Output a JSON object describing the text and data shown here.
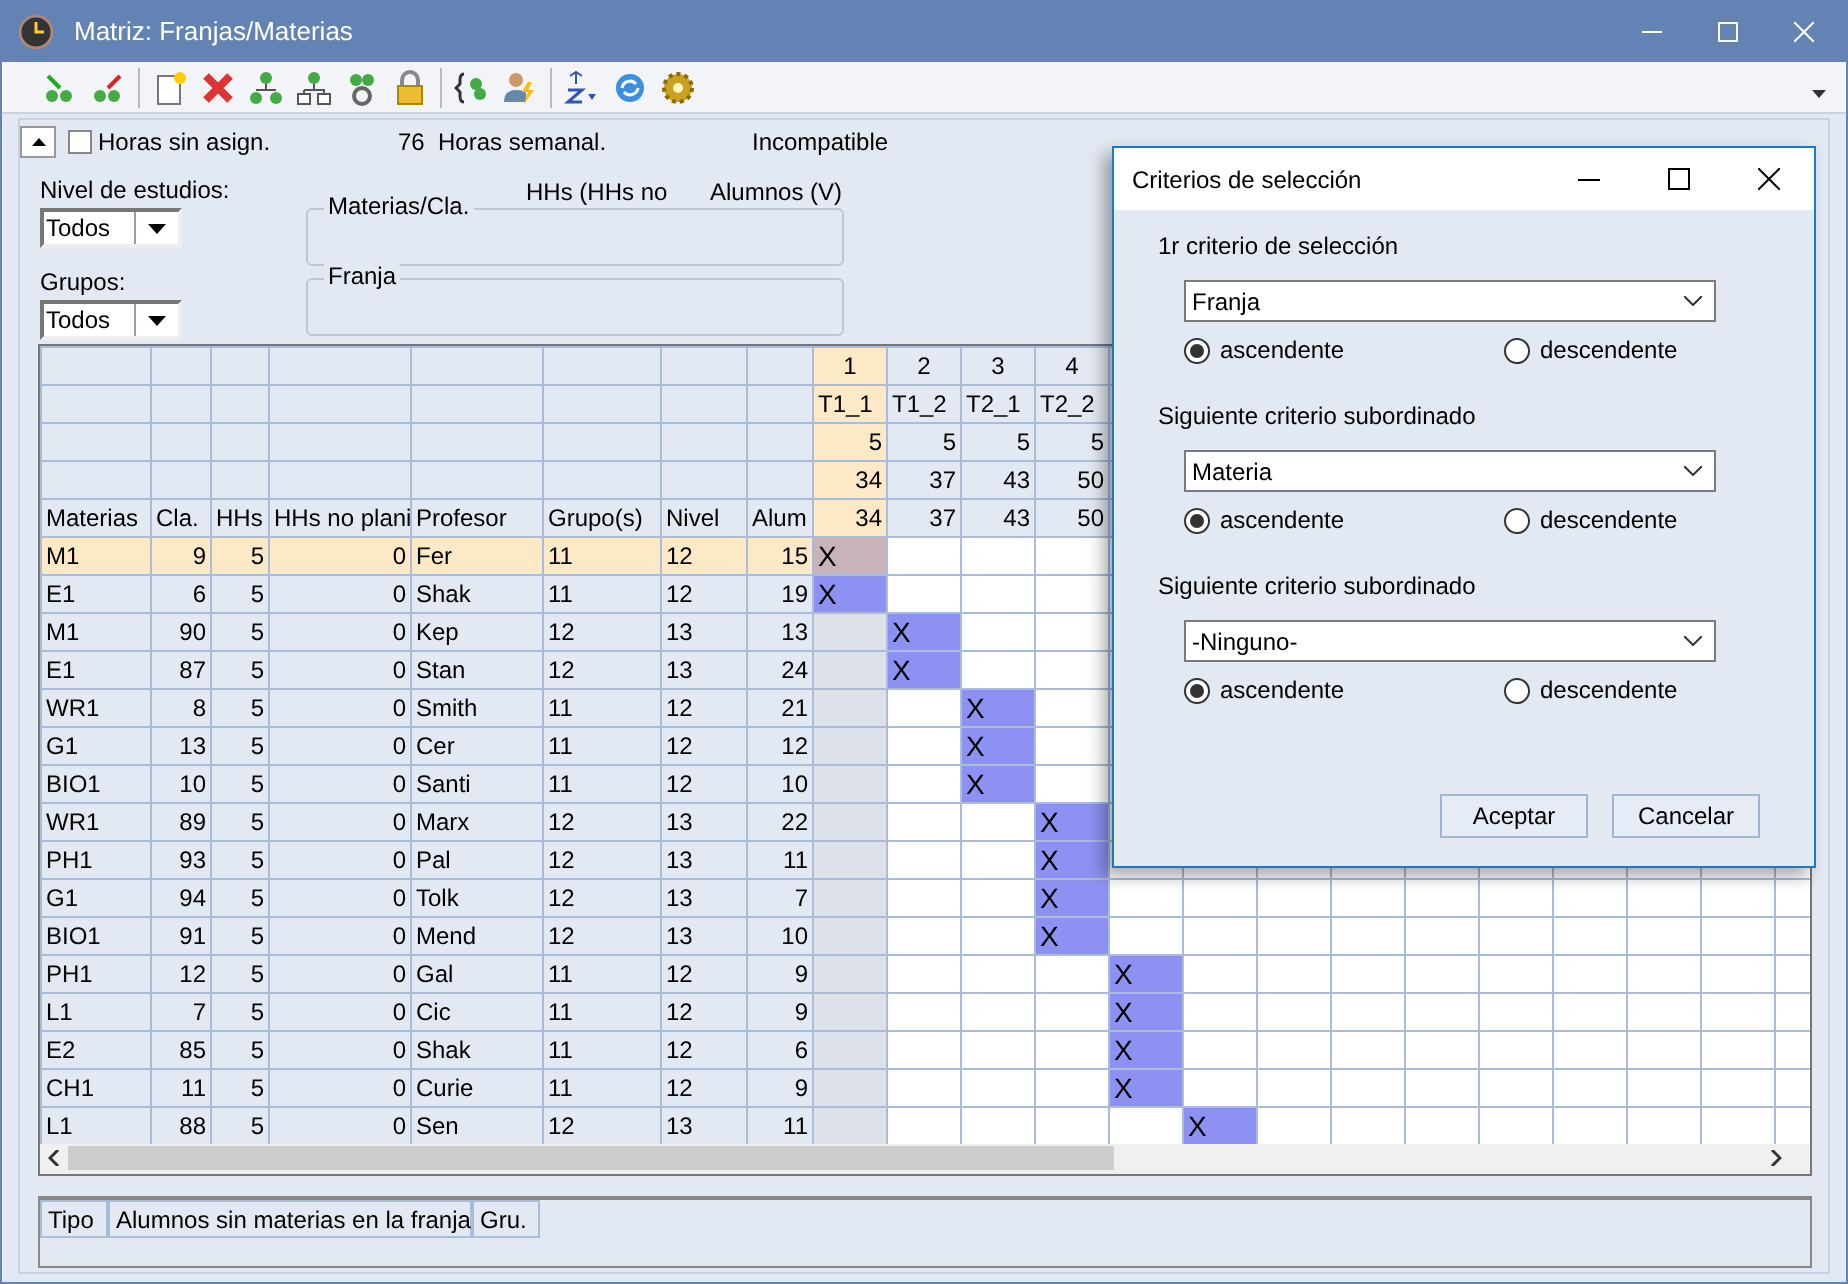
{
  "window": {
    "title": "Matriz: Franjas/Materias"
  },
  "top": {
    "unassigned_checkbox": {
      "label": "Horas sin asign.",
      "checked": false
    },
    "hours_count": "76",
    "hours_label": "Horas semanal.",
    "incompatible_label": "Incompatible",
    "hhs_label": "HHs (HHs no",
    "students_label": "Alumnos (V)"
  },
  "filters": [
    {
      "label": "Nivel de estudios:",
      "value": "Todos"
    },
    {
      "label": "Grupos:",
      "value": "Todos"
    }
  ],
  "group_boxes": [
    "Materias/Cla.",
    "Franja"
  ],
  "grid": {
    "columns": [
      "Materias",
      "Cla.",
      "HHs",
      "HHs no plani",
      "Profesor",
      "Grupo(s)",
      "Nivel",
      "Alum"
    ],
    "slots": [
      {
        "number": "1",
        "name": "T1_1",
        "hours": "5",
        "value_1": "34",
        "value_2": "34",
        "selected": true
      },
      {
        "number": "2",
        "name": "T1_2",
        "hours": "5",
        "value_1": "37",
        "value_2": "37",
        "selected": false
      },
      {
        "number": "3",
        "name": "T2_1",
        "hours": "5",
        "value_1": "43",
        "value_2": "43",
        "selected": false
      },
      {
        "number": "4",
        "name": "T2_2",
        "hours": "5",
        "value_1": "50",
        "value_2": "50",
        "selected": false
      }
    ],
    "rows": [
      {
        "cells": [
          "M1",
          "9",
          "5",
          "0",
          "Fer",
          "11",
          "12",
          "15"
        ],
        "slot_cells": [
          {
            "kind": "marked",
            "text": "X"
          }
        ],
        "selected": true
      },
      {
        "cells": [
          "E1",
          "6",
          "5",
          "0",
          "Shak",
          "11",
          "12",
          "19"
        ],
        "slot_cells": [
          {
            "kind": "marked",
            "text": "X"
          }
        ],
        "selected": false
      },
      {
        "cells": [
          "M1",
          "90",
          "5",
          "0",
          "Kep",
          "12",
          "13",
          "13"
        ],
        "slot_cells": [
          {
            "kind": "empty"
          },
          {
            "kind": "marked",
            "text": "X"
          }
        ],
        "selected": false
      },
      {
        "cells": [
          "E1",
          "87",
          "5",
          "0",
          "Stan",
          "12",
          "13",
          "24"
        ],
        "slot_cells": [
          {
            "kind": "empty"
          },
          {
            "kind": "marked",
            "text": "X"
          }
        ],
        "selected": false
      },
      {
        "cells": [
          "WR1",
          "8",
          "5",
          "0",
          "Smith",
          "11",
          "12",
          "21"
        ],
        "slot_cells": [
          {
            "kind": "empty"
          },
          {
            "kind": "empty"
          },
          {
            "kind": "marked",
            "text": "X"
          }
        ],
        "selected": false
      },
      {
        "cells": [
          "G1",
          "13",
          "5",
          "0",
          "Cer",
          "11",
          "12",
          "12"
        ],
        "slot_cells": [
          {
            "kind": "empty"
          },
          {
            "kind": "empty"
          },
          {
            "kind": "marked",
            "text": "X"
          }
        ],
        "selected": false
      },
      {
        "cells": [
          "BIO1",
          "10",
          "5",
          "0",
          "Santi",
          "11",
          "12",
          "10"
        ],
        "slot_cells": [
          {
            "kind": "empty"
          },
          {
            "kind": "empty"
          },
          {
            "kind": "marked",
            "text": "X"
          }
        ],
        "selected": false
      },
      {
        "cells": [
          "WR1",
          "89",
          "5",
          "0",
          "Marx",
          "12",
          "13",
          "22"
        ],
        "slot_cells": [
          {
            "kind": "empty"
          },
          {
            "kind": "empty"
          },
          {
            "kind": "empty"
          },
          {
            "kind": "marked",
            "text": "X"
          }
        ],
        "selected": false
      },
      {
        "cells": [
          "PH1",
          "93",
          "5",
          "0",
          "Pal",
          "12",
          "13",
          "11"
        ],
        "slot_cells": [
          {
            "kind": "empty"
          },
          {
            "kind": "empty"
          },
          {
            "kind": "empty"
          },
          {
            "kind": "marked",
            "text": "X"
          }
        ],
        "selected": false
      },
      {
        "cells": [
          "G1",
          "94",
          "5",
          "0",
          "Tolk",
          "12",
          "13",
          "7"
        ],
        "slot_cells": [
          {
            "kind": "empty"
          },
          {
            "kind": "empty"
          },
          {
            "kind": "empty"
          },
          {
            "kind": "marked",
            "text": "X"
          }
        ],
        "selected": false
      },
      {
        "cells": [
          "BIO1",
          "91",
          "5",
          "0",
          "Mend",
          "12",
          "13",
          "10"
        ],
        "slot_cells": [
          {
            "kind": "empty"
          },
          {
            "kind": "empty"
          },
          {
            "kind": "empty"
          },
          {
            "kind": "marked",
            "text": "X"
          }
        ],
        "selected": false
      },
      {
        "cells": [
          "PH1",
          "12",
          "5",
          "0",
          "Gal",
          "11",
          "12",
          "9"
        ],
        "slot_cells": [
          {
            "kind": "empty"
          },
          {
            "kind": "empty"
          },
          {
            "kind": "empty"
          },
          {
            "kind": "empty"
          },
          {
            "kind": "marked",
            "text": "X"
          }
        ],
        "selected": false
      },
      {
        "cells": [
          "L1",
          "7",
          "5",
          "0",
          "Cic",
          "11",
          "12",
          "9"
        ],
        "slot_cells": [
          {
            "kind": "empty"
          },
          {
            "kind": "empty"
          },
          {
            "kind": "empty"
          },
          {
            "kind": "empty"
          },
          {
            "kind": "marked",
            "text": "X"
          }
        ],
        "selected": false
      },
      {
        "cells": [
          "E2",
          "85",
          "5",
          "0",
          "Shak",
          "11",
          "12",
          "6"
        ],
        "slot_cells": [
          {
            "kind": "empty"
          },
          {
            "kind": "empty"
          },
          {
            "kind": "empty"
          },
          {
            "kind": "empty"
          },
          {
            "kind": "marked",
            "text": "X"
          }
        ],
        "selected": false
      },
      {
        "cells": [
          "CH1",
          "11",
          "5",
          "0",
          "Curie",
          "11",
          "12",
          "9"
        ],
        "slot_cells": [
          {
            "kind": "empty"
          },
          {
            "kind": "empty"
          },
          {
            "kind": "empty"
          },
          {
            "kind": "empty"
          },
          {
            "kind": "marked",
            "text": "X"
          }
        ],
        "selected": false
      },
      {
        "cells": [
          "L1",
          "88",
          "5",
          "0",
          "Sen",
          "12",
          "13",
          "11"
        ],
        "slot_cells": [
          {
            "kind": "empty"
          },
          {
            "kind": "empty"
          },
          {
            "kind": "empty"
          },
          {
            "kind": "empty"
          },
          {
            "kind": "empty"
          },
          {
            "kind": "marked",
            "text": "X"
          }
        ],
        "selected": false
      }
    ]
  },
  "bottom_table": {
    "columns": [
      "Tipo",
      "Alumnos sin materias en la franja",
      "Gru."
    ]
  },
  "dialog": {
    "title": "Criterios de selección",
    "criteria": [
      {
        "label": "1r criterio de selección",
        "value": "Franja",
        "options": [
          {
            "label": "ascendente",
            "selected": true
          },
          {
            "label": "descendente",
            "selected": false
          }
        ]
      },
      {
        "label": "Siguiente criterio subordinado",
        "value": "Materia",
        "options": [
          {
            "label": "ascendente",
            "selected": true
          },
          {
            "label": "descendente",
            "selected": false
          }
        ]
      },
      {
        "label": "Siguiente criterio subordinado",
        "value": "-Ninguno-",
        "options": [
          {
            "label": "ascendente",
            "selected": true
          },
          {
            "label": "descendente",
            "selected": false
          }
        ]
      }
    ],
    "buttons": [
      "Aceptar",
      "Cancelar"
    ]
  }
}
